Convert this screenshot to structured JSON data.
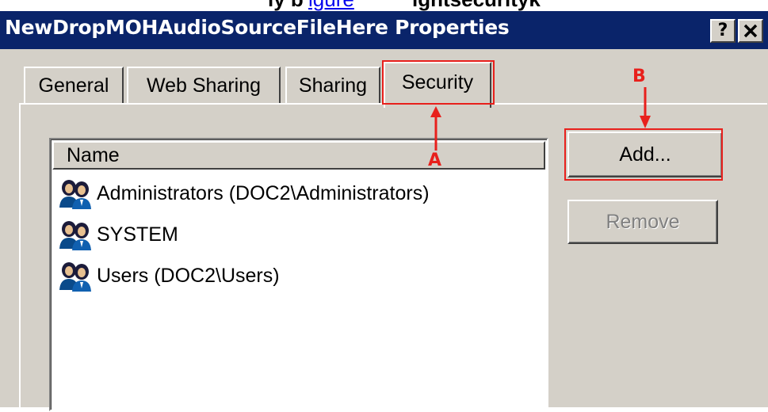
{
  "page_strip": {
    "prefix": "ly b",
    "link": "igure",
    "suffix": "ightsecurityk"
  },
  "window": {
    "title": "NewDropMOHAudioSourceFileHere Properties",
    "help_glyph": "?",
    "close_glyph": "✕"
  },
  "tabs": [
    {
      "label": "General",
      "active": false
    },
    {
      "label": "Web Sharing",
      "active": false
    },
    {
      "label": "Sharing",
      "active": false
    },
    {
      "label": "Security",
      "active": true
    }
  ],
  "list": {
    "column_header": "Name",
    "rows": [
      {
        "label": "Administrators (DOC2\\Administrators)",
        "icon": "user-group-icon"
      },
      {
        "label": "SYSTEM",
        "icon": "user-group-icon"
      },
      {
        "label": "Users (DOC2\\Users)",
        "icon": "user-group-icon"
      }
    ]
  },
  "buttons": {
    "add": "Add...",
    "remove": "Remove"
  },
  "annotations": {
    "a": "A",
    "b": "B",
    "color": "#e8201c"
  },
  "colors": {
    "titlebar": "#0a246a",
    "face": "#d4d0c8",
    "link": "#0000ee"
  }
}
